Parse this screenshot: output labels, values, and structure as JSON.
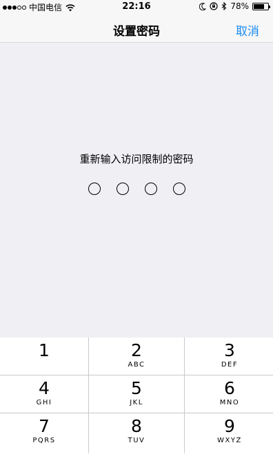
{
  "status_bar": {
    "signal_filled": 3,
    "signal_empty": 2,
    "carrier": "中国电信",
    "time": "22:16",
    "battery_pct": "78%",
    "battery_level": 0.78
  },
  "nav": {
    "title": "设置密码",
    "cancel_label": "取消"
  },
  "prompt": "重新输入访问限制的密码",
  "passcode": {
    "length": 4,
    "entered": 0
  },
  "keypad": {
    "keys": [
      {
        "num": "1",
        "letters": ""
      },
      {
        "num": "2",
        "letters": "ABC"
      },
      {
        "num": "3",
        "letters": "DEF"
      },
      {
        "num": "4",
        "letters": "GHI"
      },
      {
        "num": "5",
        "letters": "JKL"
      },
      {
        "num": "6",
        "letters": "MNO"
      },
      {
        "num": "7",
        "letters": "PQRS"
      },
      {
        "num": "8",
        "letters": "TUV"
      },
      {
        "num": "9",
        "letters": "WXYZ"
      }
    ]
  },
  "colors": {
    "accent": "#1a8bf0",
    "background": "#efeff4"
  },
  "icons": [
    "signal-dots-icon",
    "wifi-icon",
    "moon-icon",
    "rotation-lock-icon",
    "bluetooth-icon",
    "battery-icon"
  ]
}
